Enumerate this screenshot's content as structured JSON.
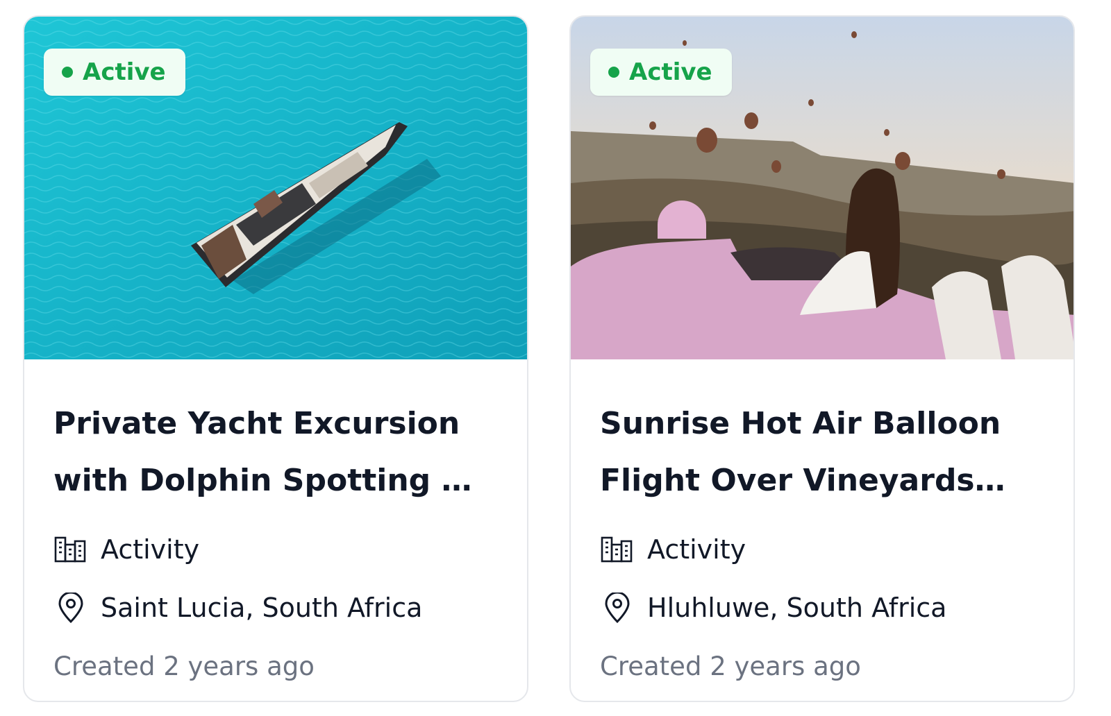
{
  "listings": [
    {
      "status": "Active",
      "title": "Private Yacht Excursion with Dolphin Spotting & Champagne Lunch",
      "category": "Activity",
      "category_icon": "buildings-icon",
      "location": "Saint Lucia, South Africa",
      "location_icon": "map-pin-icon",
      "created": "Created 2 years ago",
      "image_subject": "yacht-on-turquoise-sea"
    },
    {
      "status": "Active",
      "title": "Sunrise Hot Air Balloon Flight Over Vineyards with Breakfast",
      "category": "Activity",
      "category_icon": "buildings-icon",
      "location": "Hluhluwe, South Africa",
      "location_icon": "map-pin-icon",
      "created": "Created 2 years ago",
      "image_subject": "woman-in-pink-car-watching-hot-air-balloons"
    }
  ],
  "colors": {
    "status_active": "#16a34a",
    "status_bg": "#f0fdf4",
    "title": "#111827",
    "muted": "#6b7280"
  }
}
